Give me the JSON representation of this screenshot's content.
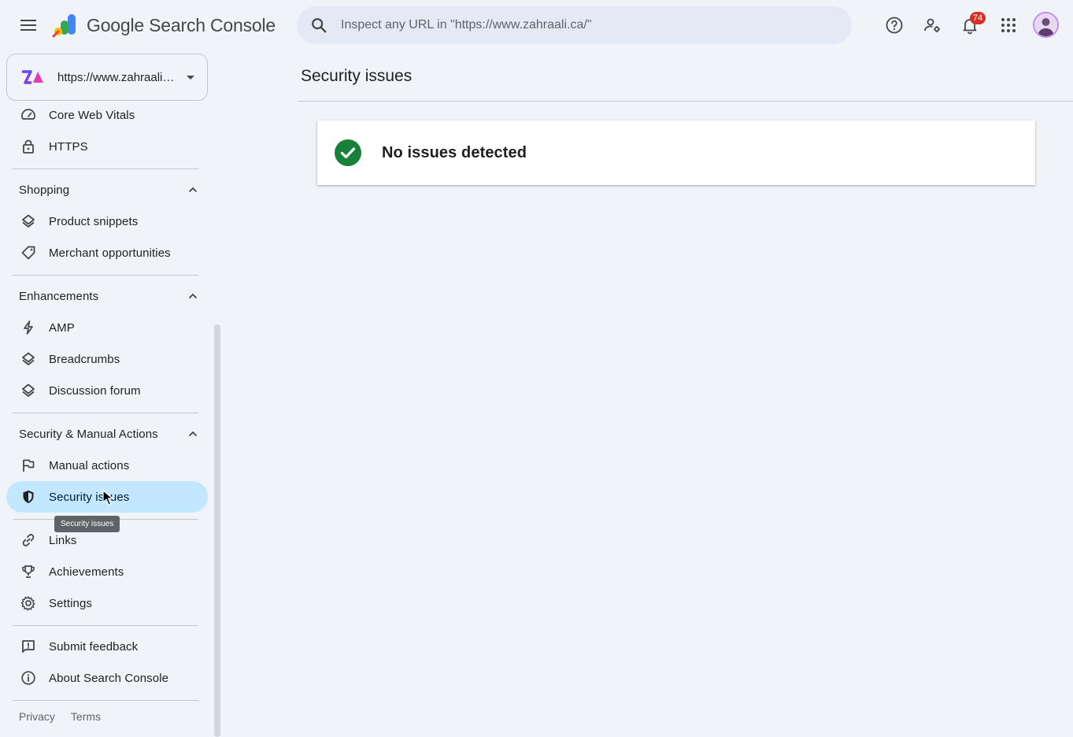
{
  "app": {
    "title": "Google Search Console"
  },
  "header": {
    "search_placeholder": "Inspect any URL in \"https://www.zahraali.ca/\"",
    "notifications_count": "74"
  },
  "property": {
    "label": "https://www.zahraali...."
  },
  "sidebar": {
    "experience_items": [
      {
        "label": "Core Web Vitals",
        "icon": "speedometer-icon"
      },
      {
        "label": "HTTPS",
        "icon": "lock-icon"
      }
    ],
    "shopping": {
      "title": "Shopping",
      "items": [
        {
          "label": "Product snippets",
          "icon": "layers-icon"
        },
        {
          "label": "Merchant opportunities",
          "icon": "tag-icon"
        }
      ]
    },
    "enhancements": {
      "title": "Enhancements",
      "items": [
        {
          "label": "AMP",
          "icon": "bolt-icon"
        },
        {
          "label": "Breadcrumbs",
          "icon": "layers-icon"
        },
        {
          "label": "Discussion forum",
          "icon": "layers-icon"
        }
      ]
    },
    "security": {
      "title": "Security & Manual Actions",
      "items": [
        {
          "label": "Manual actions",
          "icon": "flag-icon"
        },
        {
          "label": "Security issues",
          "icon": "shield-icon"
        }
      ]
    },
    "other_items": [
      {
        "label": "Links",
        "icon": "link-icon"
      },
      {
        "label": "Achievements",
        "icon": "trophy-icon"
      },
      {
        "label": "Settings",
        "icon": "gear-icon"
      }
    ],
    "bottom_items": [
      {
        "label": "Submit feedback",
        "icon": "feedback-icon"
      },
      {
        "label": "About Search Console",
        "icon": "info-icon"
      }
    ],
    "footer": {
      "privacy": "Privacy",
      "terms": "Terms"
    },
    "tooltip": "Security issues"
  },
  "main": {
    "title": "Security issues",
    "status_text": "No issues detected"
  },
  "colors": {
    "background": "#f0f4f9",
    "active_item": "#c2e7ff",
    "success": "#188038",
    "badge": "#d93025"
  }
}
